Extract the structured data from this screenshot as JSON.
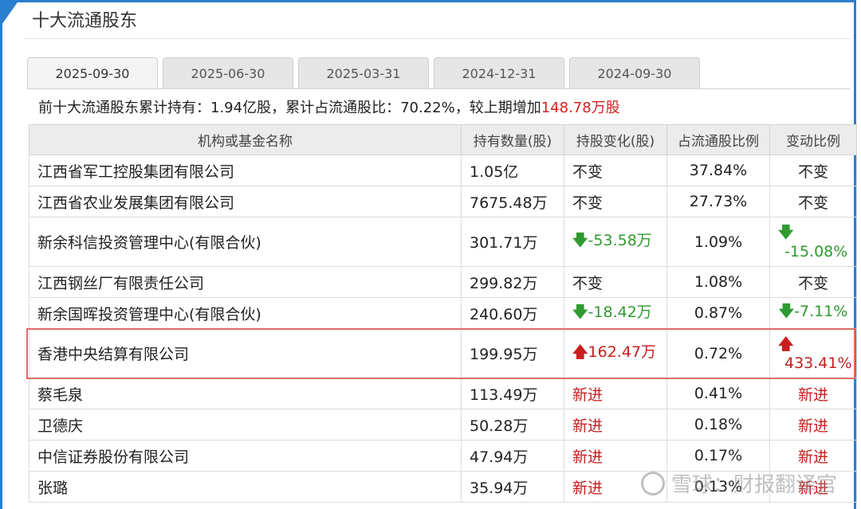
{
  "section_title": "十大流通股东",
  "tabs": [
    {
      "label": "2025-09-30",
      "active": true
    },
    {
      "label": "2025-06-30",
      "active": false
    },
    {
      "label": "2025-03-31",
      "active": false
    },
    {
      "label": "2024-12-31",
      "active": false
    },
    {
      "label": "2024-09-30",
      "active": false
    }
  ],
  "summary": {
    "prefix": "前十大流通股东累计持有：",
    "total": "1.94亿股",
    "mid": "，累计占流通股比：",
    "ratio": "70.22%",
    "mid2": "，较上期增加",
    "increase": "148.78万股"
  },
  "table": {
    "headers": [
      "机构或基金名称",
      "持有数量(股)",
      "持股变化(股)",
      "占流通股比例",
      "变动比例"
    ],
    "rows": [
      {
        "name": "江西省军工控股集团有限公司",
        "qty": "1.05亿",
        "change": "不变",
        "change_dir": "none",
        "pct": "37.84%",
        "ratio": "不变",
        "ratio_dir": "none"
      },
      {
        "name": "江西省农业发展集团有限公司",
        "qty": "7675.48万",
        "change": "不变",
        "change_dir": "none",
        "pct": "27.73%",
        "ratio": "不变",
        "ratio_dir": "none"
      },
      {
        "name": "新余科信投资管理中心(有限合伙)",
        "qty": "301.71万",
        "change": "-53.58万",
        "change_dir": "down",
        "pct": "1.09%",
        "ratio": "-15.08%",
        "ratio_dir": "down"
      },
      {
        "name": "江西钢丝厂有限责任公司",
        "qty": "299.82万",
        "change": "不变",
        "change_dir": "none",
        "pct": "1.08%",
        "ratio": "不变",
        "ratio_dir": "none"
      },
      {
        "name": "新余国晖投资管理中心(有限合伙)",
        "qty": "240.60万",
        "change": "-18.42万",
        "change_dir": "down",
        "pct": "0.87%",
        "ratio": "-7.11%",
        "ratio_dir": "down"
      },
      {
        "name": "香港中央结算有限公司",
        "qty": "199.95万",
        "change": "162.47万",
        "change_dir": "up",
        "pct": "0.72%",
        "ratio": "433.41%",
        "ratio_dir": "up"
      },
      {
        "name": "蔡毛泉",
        "qty": "113.49万",
        "change": "新进",
        "change_dir": "new",
        "pct": "0.41%",
        "ratio": "新进",
        "ratio_dir": "new"
      },
      {
        "name": "卫德庆",
        "qty": "50.28万",
        "change": "新进",
        "change_dir": "new",
        "pct": "0.18%",
        "ratio": "新进",
        "ratio_dir": "new"
      },
      {
        "name": "中信证券股份有限公司",
        "qty": "47.94万",
        "change": "新进",
        "change_dir": "new",
        "pct": "0.17%",
        "ratio": "新进",
        "ratio_dir": "new"
      },
      {
        "name": "张璐",
        "qty": "35.94万",
        "change": "新进",
        "change_dir": "new",
        "pct": "0.13%",
        "ratio": "新进",
        "ratio_dir": "new"
      }
    ]
  },
  "watermark": "雪球：财报翻译官",
  "colors": {
    "accent": "#2a7fd0",
    "up": "#c81e1e",
    "down": "#2f9a2f",
    "highlight": "#e06b6b"
  }
}
